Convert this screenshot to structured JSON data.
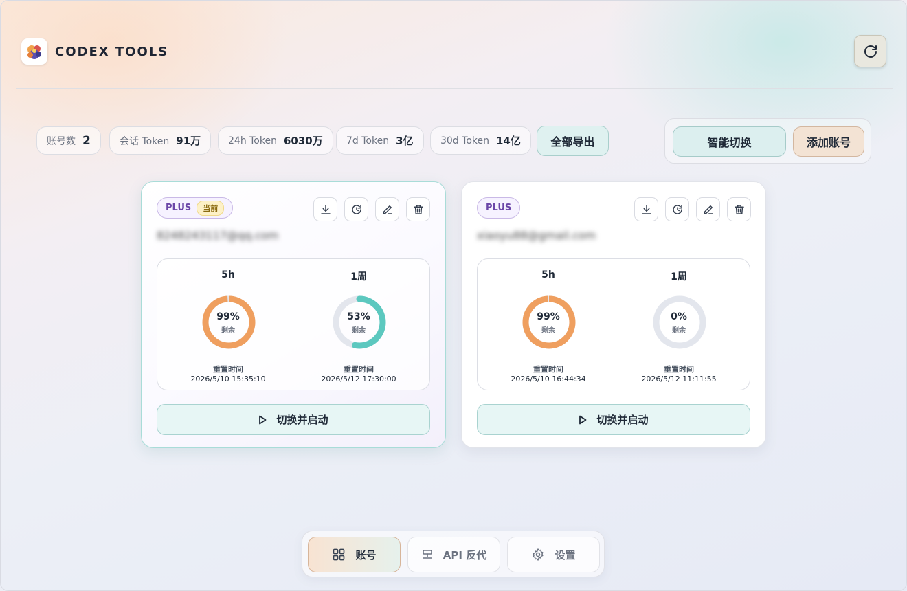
{
  "app": {
    "title": "CODEX TOOLS"
  },
  "stats": [
    {
      "label": "账号数",
      "value": "2"
    },
    {
      "label": "会话 Token",
      "value": "91万"
    },
    {
      "label": "24h Token",
      "value": "6030万"
    },
    {
      "label": "7d Token",
      "value": "3亿"
    },
    {
      "label": "30d Token",
      "value": "14亿"
    }
  ],
  "toolbar": {
    "export_label": "全部导出",
    "smart_switch_label": "智能切换",
    "add_account_label": "添加账号"
  },
  "accounts": [
    {
      "plan": "PLUS",
      "current_tag": "当前",
      "email": "8248243117@qq.com",
      "usage": [
        {
          "label": "5h",
          "percent": "99%",
          "fill": 0.99,
          "color": "#ef9f5f",
          "sub": "剩余",
          "reset_label": "重置时间",
          "reset_time": "2026/5/10 15:35:10"
        },
        {
          "label": "1周",
          "percent": "53%",
          "fill": 0.53,
          "color": "#5cc8bf",
          "sub": "剩余",
          "reset_label": "重置时间",
          "reset_time": "2026/5/12 17:30:00"
        }
      ],
      "launch_label": "切换并启动"
    },
    {
      "plan": "PLUS",
      "current_tag": "",
      "email": "xiaoyu88@gmail.com",
      "usage": [
        {
          "label": "5h",
          "percent": "99%",
          "fill": 0.99,
          "color": "#ef9f5f",
          "sub": "剩余",
          "reset_label": "重置时间",
          "reset_time": "2026/5/10 16:44:34"
        },
        {
          "label": "1周",
          "percent": "0%",
          "fill": 0.0,
          "color": "#5cc8bf",
          "sub": "剩余",
          "reset_label": "重置时间",
          "reset_time": "2026/5/12 11:11:55"
        }
      ],
      "launch_label": "切换并启动"
    }
  ],
  "nav": [
    {
      "label": "账号",
      "icon": "grid-icon",
      "active": true
    },
    {
      "label": "API 反代",
      "icon": "server-icon",
      "active": false
    },
    {
      "label": "设置",
      "icon": "gear-icon",
      "active": false
    }
  ],
  "icons": [
    "refresh-icon",
    "download-icon",
    "history-icon",
    "edit-icon",
    "trash-icon",
    "play-icon"
  ],
  "colors": {
    "ring_track": "#e3e6ed",
    "accent_orange": "#ef9f5f",
    "accent_teal": "#5cc8bf",
    "plan_purple": "#6b46a8"
  }
}
